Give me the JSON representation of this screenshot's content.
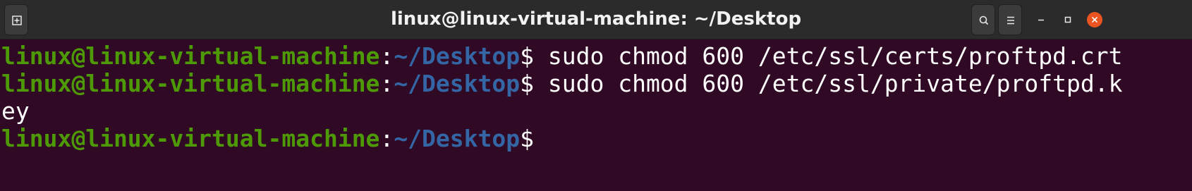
{
  "window": {
    "title": "linux@linux-virtual-machine: ~/Desktop"
  },
  "titlebar": {
    "new_tab_icon": "new-tab-icon",
    "search_icon": "search-icon",
    "menu_icon": "hamburger-menu-icon",
    "minimize_icon": "minimize-icon",
    "maximize_icon": "maximize-icon",
    "close_icon": "close-icon",
    "close_color": "#e95420"
  },
  "terminal": {
    "colors": {
      "background": "#300a24",
      "user": "#4e9a06",
      "path": "#3465a4",
      "text": "#ffffff"
    },
    "lines": [
      {
        "user": "linux@linux-virtual-machine",
        "sep": ":",
        "path": "~/Desktop",
        "prompt": "$",
        "command": " sudo chmod 600 /etc/ssl/certs/proftpd.crt"
      },
      {
        "user": "linux@linux-virtual-machine",
        "sep": ":",
        "path": "~/Desktop",
        "prompt": "$",
        "command": " sudo chmod 600 /etc/ssl/private/proftpd.k"
      },
      {
        "text": "ey"
      },
      {
        "user": "linux@linux-virtual-machine",
        "sep": ":",
        "path": "~/Desktop",
        "prompt": "$",
        "command": ""
      }
    ]
  }
}
